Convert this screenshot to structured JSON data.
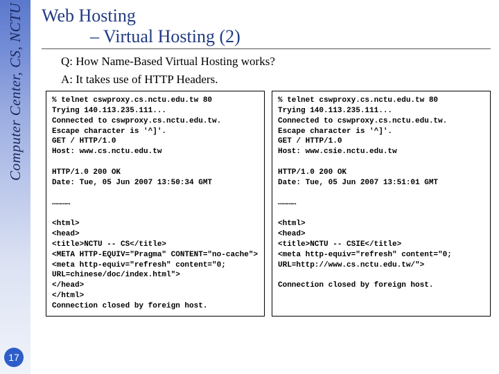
{
  "sidebar": {
    "text": "Computer Center, CS, NCTU"
  },
  "page_number": "17",
  "title": {
    "line1": "Web Hosting",
    "line2": "– Virtual Hosting (2)"
  },
  "qa": {
    "q": "Q: How Name-Based Virtual Hosting works?",
    "a": "A: It takes use of HTTP Headers."
  },
  "left_col": "% telnet cswproxy.cs.nctu.edu.tw 80\nTrying 140.113.235.111...\nConnected to cswproxy.cs.nctu.edu.tw.\nEscape character is '^]'.\nGET / HTTP/1.0\nHost: www.cs.nctu.edu.tw\n\nHTTP/1.0 200 OK\nDate: Tue, 05 Jun 2007 13:50:34 GMT\n\n…………\n\n<html>\n<head>\n<title>NCTU -- CS</title>\n<META HTTP-EQUIV=\"Pragma\" CONTENT=\"no-cache\">\n<meta http-equiv=\"refresh\" content=\"0; URL=chinese/doc/index.html\">\n</head>\n</html>\nConnection closed by foreign host.",
  "right_col": "% telnet cswproxy.cs.nctu.edu.tw 80\nTrying 140.113.235.111...\nConnected to cswproxy.cs.nctu.edu.tw.\nEscape character is '^]'.\nGET / HTTP/1.0\nHost: www.csie.nctu.edu.tw\n\nHTTP/1.0 200 OK\nDate: Tue, 05 Jun 2007 13:51:01 GMT\n\n…………\n\n<html>\n<head>\n<title>NCTU -- CSIE</title>\n<meta http-equiv=\"refresh\" content=\"0; URL=http://www.cs.nctu.edu.tw/\">\n\nConnection closed by foreign host."
}
